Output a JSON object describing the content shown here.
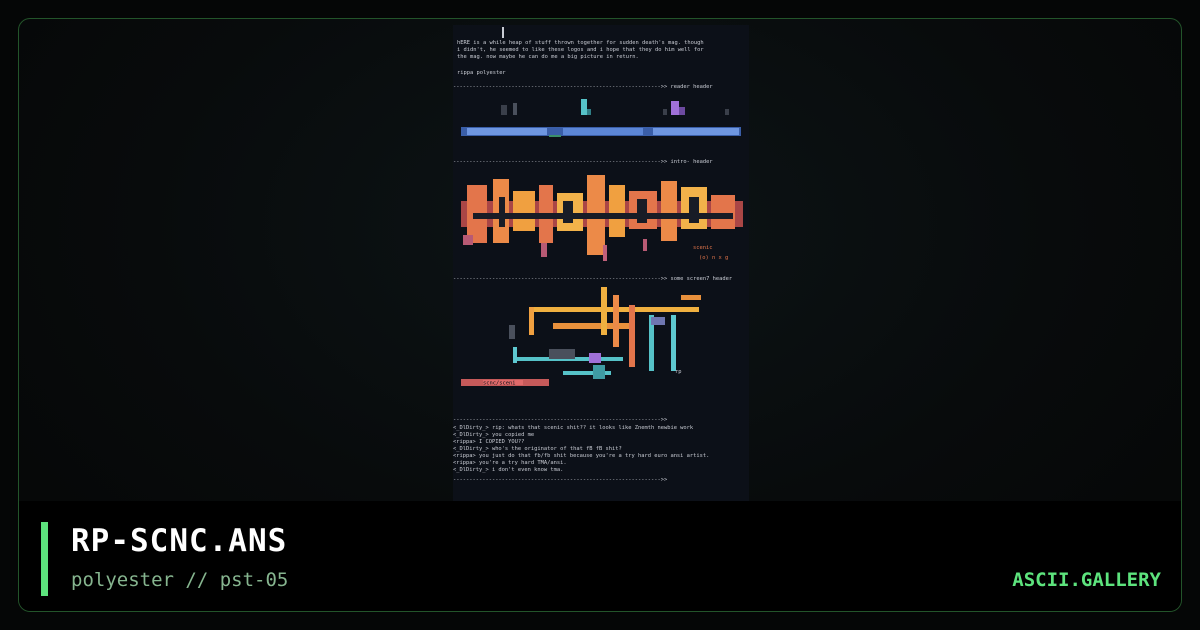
{
  "artwork": {
    "filename": "RP-SCNC.ANS",
    "byline": "polyester // pst-05",
    "site": "ASCII.GALLERY"
  },
  "ansi_preview": {
    "intro_lines": [
      "hERE is a while heap of stuff thrown together for sudden death's mag. though",
      "i didn't, he seemed to like these logos and i hope that they do him well for",
      "the mag. now maybe he can do me a big picture in return.",
      "",
      "rippa polyester"
    ],
    "section_headers": [
      "---------------------------------------------------------------->> reader header",
      "---------------------------------------------------------------->> intro- header",
      "---------------------------------------------------------------->> some screen7 header",
      "---------------------------------------------------------------->>"
    ],
    "logo_caption": [
      "scenic",
      "(o) n x g"
    ],
    "rp_tag": "rp",
    "pink_label": "scnc/sceni",
    "chat_lines": [
      "<_DlDirty_> rip: whats that scenic shit?? it looks like Znemth newbie work",
      "<_DlDirty_> you copied me",
      "<rippa> I COPIED YOU??",
      "<_DlDirty_> who's the originator of that fB fB shit?",
      "<rippa> you just do that fb/fb shit because you're a try hard euro ansi artist.",
      "<rippa> you're a try hard TMA/ansi.",
      "<_DlDirty_> i don't even know tma."
    ],
    "closing_rule": "---------------------------------------------------------------->>"
  },
  "colors": {
    "accent": "#5de37d",
    "subtitle": "#86b58f",
    "border": "#23542a",
    "preview_bg": "#0c1018"
  }
}
